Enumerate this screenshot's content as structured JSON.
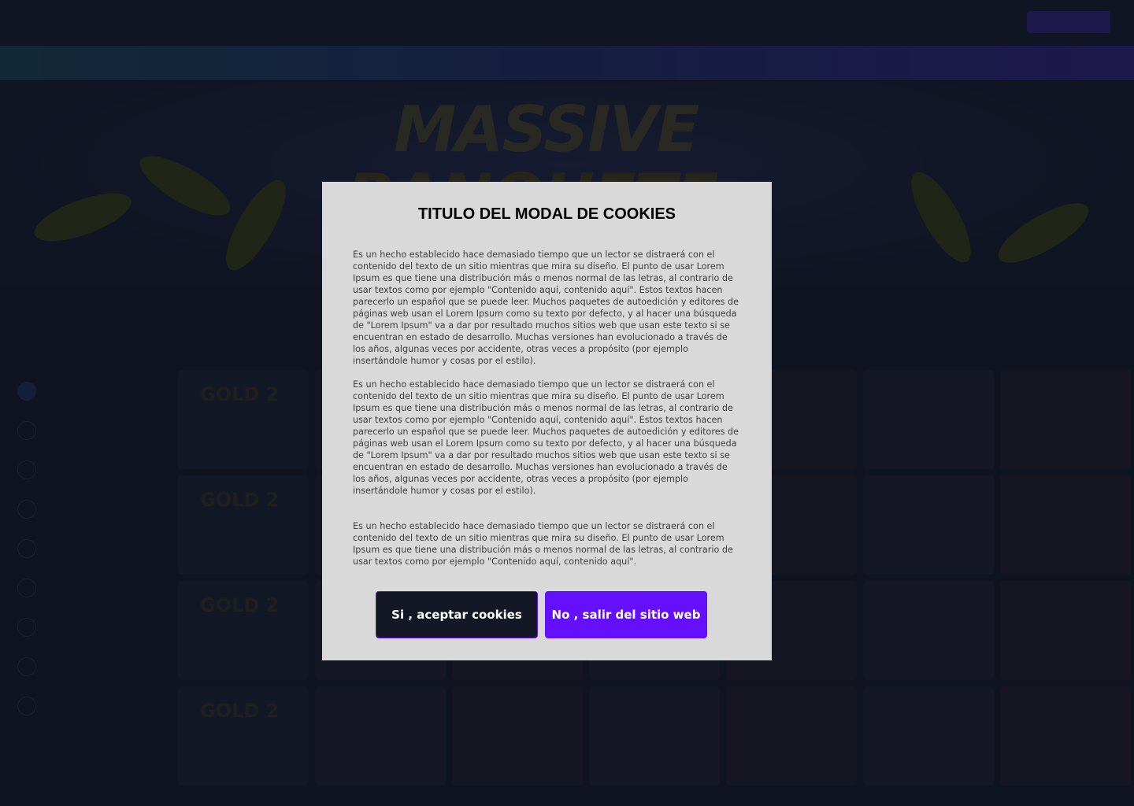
{
  "modal": {
    "title": "TITULO DEL MODAL DE COOKIES",
    "paragraphs": [
      "Es un hecho establecido hace demasiado tiempo que un lector se distraerá con el contenido del texto de un sitio mientras que mira su diseño. El punto de usar Lorem Ipsum es que tiene una distribución más o menos normal de las letras, al contrario de usar textos como por ejemplo \"Contenido aquí, contenido aquí\". Estos textos hacen parecerlo un español que se puede leer. Muchos paquetes de autoedición y editores de páginas web usan el Lorem Ipsum como su texto por defecto, y al hacer una búsqueda de \"Lorem Ipsum\" va a dar por resultado muchos sitios web que usan este texto si se encuentran en estado de desarrollo. Muchas versiones han evolucionado a través de los años, algunas veces por accidente, otras veces a propósito (por ejemplo insertándole humor y cosas por el estilo).",
      "Es un hecho establecido hace demasiado tiempo que un lector se distraerá con el contenido del texto de un sitio mientras que mira su diseño. El punto de usar Lorem Ipsum es que tiene una distribución más o menos normal de las letras, al contrario de usar textos como por ejemplo \"Contenido aquí, contenido aquí\". Estos textos hacen parecerlo un español que se puede leer. Muchos paquetes de autoedición y editores de páginas web usan el Lorem Ipsum como su texto por defecto, y al hacer una búsqueda de \"Lorem Ipsum\" va a dar por resultado muchos sitios web que usan este texto si se encuentran en estado de desarrollo. Muchas versiones han evolucionado a través de los años, algunas veces por accidente, otras veces a propósito (por ejemplo insertándole humor y cosas por el estilo).",
      "Es un hecho establecido hace demasiado tiempo que un lector se distraerá con el contenido del texto de un sitio mientras que mira su diseño. El punto de usar Lorem Ipsum es que tiene una distribución más o menos normal de las letras, al contrario de usar textos como por ejemplo \"Contenido aquí, contenido aquí\"."
    ],
    "accept_label": "Si , aceptar cookies",
    "reject_label": "No , salir del sitio web"
  },
  "background": {
    "hero_title": "MASSIVE",
    "hero_subtitle": "BANQUETE",
    "tile_text": "GOLD 2"
  },
  "colors": {
    "accent": "#6410ff",
    "dark_button": "#141826",
    "modal_bg": "#d9d9d9",
    "page_bg": "#141826"
  }
}
